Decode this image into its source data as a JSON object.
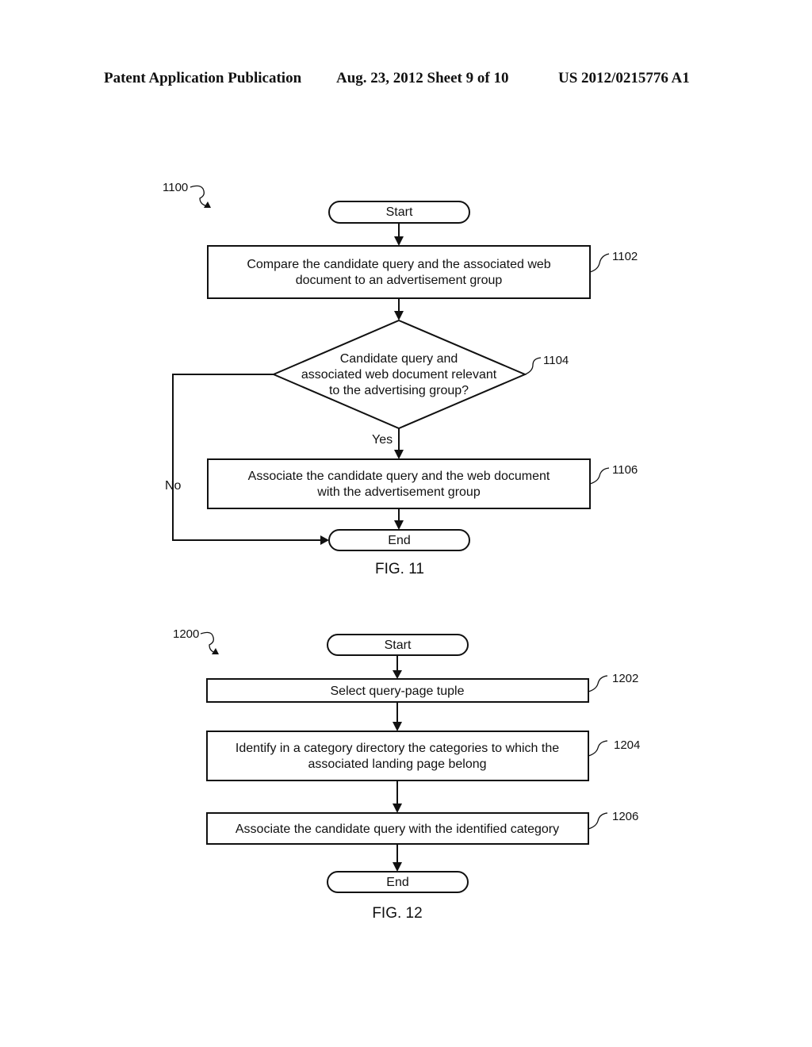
{
  "header": {
    "publication": "Patent Application Publication",
    "date_sheet": "Aug. 23, 2012  Sheet 9 of 10",
    "number": "US 2012/0215776 A1"
  },
  "fig11": {
    "ref": "1100",
    "start": "Start",
    "step1102": {
      "ref": "1102",
      "lines": [
        "Compare the candidate query and the associated web",
        "document to an advertisement group"
      ]
    },
    "decision1104": {
      "ref": "1104",
      "lines": [
        "Candidate query and",
        "associated web document relevant",
        "to the advertising group?"
      ]
    },
    "yes_label": "Yes",
    "no_label": "No",
    "step1106": {
      "ref": "1106",
      "lines": [
        "Associate the candidate query and the web document",
        "with the advertisement group"
      ]
    },
    "end": "End",
    "caption": "FIG. 11"
  },
  "fig12": {
    "ref": "1200",
    "start": "Start",
    "step1202": {
      "ref": "1202",
      "lines": [
        "Select query-page tuple"
      ]
    },
    "step1204": {
      "ref": "1204",
      "lines": [
        "Identify in a category directory the categories to which the",
        "associated landing page belong"
      ]
    },
    "step1206": {
      "ref": "1206",
      "lines": [
        "Associate the candidate query with the identified category"
      ]
    },
    "end": "End",
    "caption": "FIG. 12"
  }
}
